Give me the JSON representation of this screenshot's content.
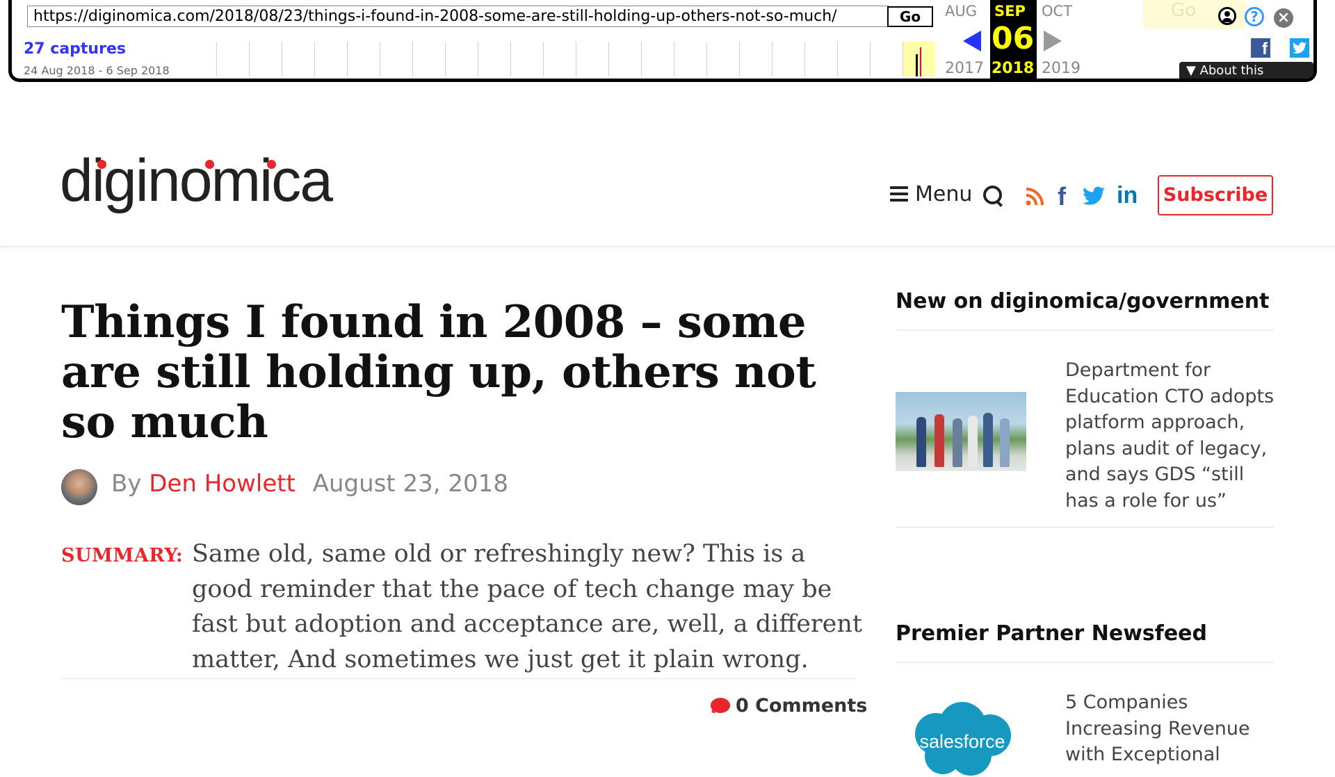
{
  "wayback": {
    "url": "https://diginomica.com/2018/08/23/things-i-found-in-2008-some-are-still-holding-up-others-not-so-much/",
    "go_label": "Go",
    "captures": "27 captures",
    "range": "24 Aug 2018 - 6 Sep 2018",
    "prev_month": "AUG",
    "cur_month": "SEP",
    "next_month": "OCT",
    "day": "06",
    "prev_year": "2017",
    "cur_year": "2018",
    "next_year": "2019",
    "goto_label": "Go",
    "about_label": "▼ About this capture",
    "icons": [
      "user-icon",
      "help-icon",
      "close-icon",
      "facebook-icon",
      "twitter-icon"
    ],
    "colors": {
      "captures": "#3333ff",
      "highlight": "#ffff00",
      "prev_arrow": "#2233ff"
    }
  },
  "header": {
    "logo_text": "diginomica",
    "menu_label": "Menu",
    "subscribe_label": "Subscribe",
    "social_icons": [
      "rss-icon",
      "facebook-icon",
      "twitter-icon",
      "linkedin-icon"
    ],
    "colors": {
      "accent": "#e8262c",
      "rss": "#f26522",
      "facebook": "#3b5998",
      "twitter": "#1da1f2",
      "linkedin": "#0077b5"
    }
  },
  "article": {
    "title": "Things I found in 2008 – some are still holding up, others not so much",
    "by": "By",
    "author": "Den Howlett",
    "date": "August 23, 2018",
    "summary_label": "SUMMARY:",
    "summary": "Same old, same old or refreshingly new? This is a good reminder that the pace of tech change may be fast but adoption and acceptance are, well, a different matter, And sometimes we just get it plain wrong.",
    "comments": "0 Comments"
  },
  "sidebar": {
    "section1_title": "New on diginomica/government",
    "section1_item": "Department for Education CTO adopts platform approach, plans audit of legacy, and says GDS “still has a role for us”",
    "section2_title": "Premier Partner Newsfeed",
    "section2_item": "5 Companies Increasing Revenue with Exceptional",
    "partner_logo_text": "salesforce"
  }
}
